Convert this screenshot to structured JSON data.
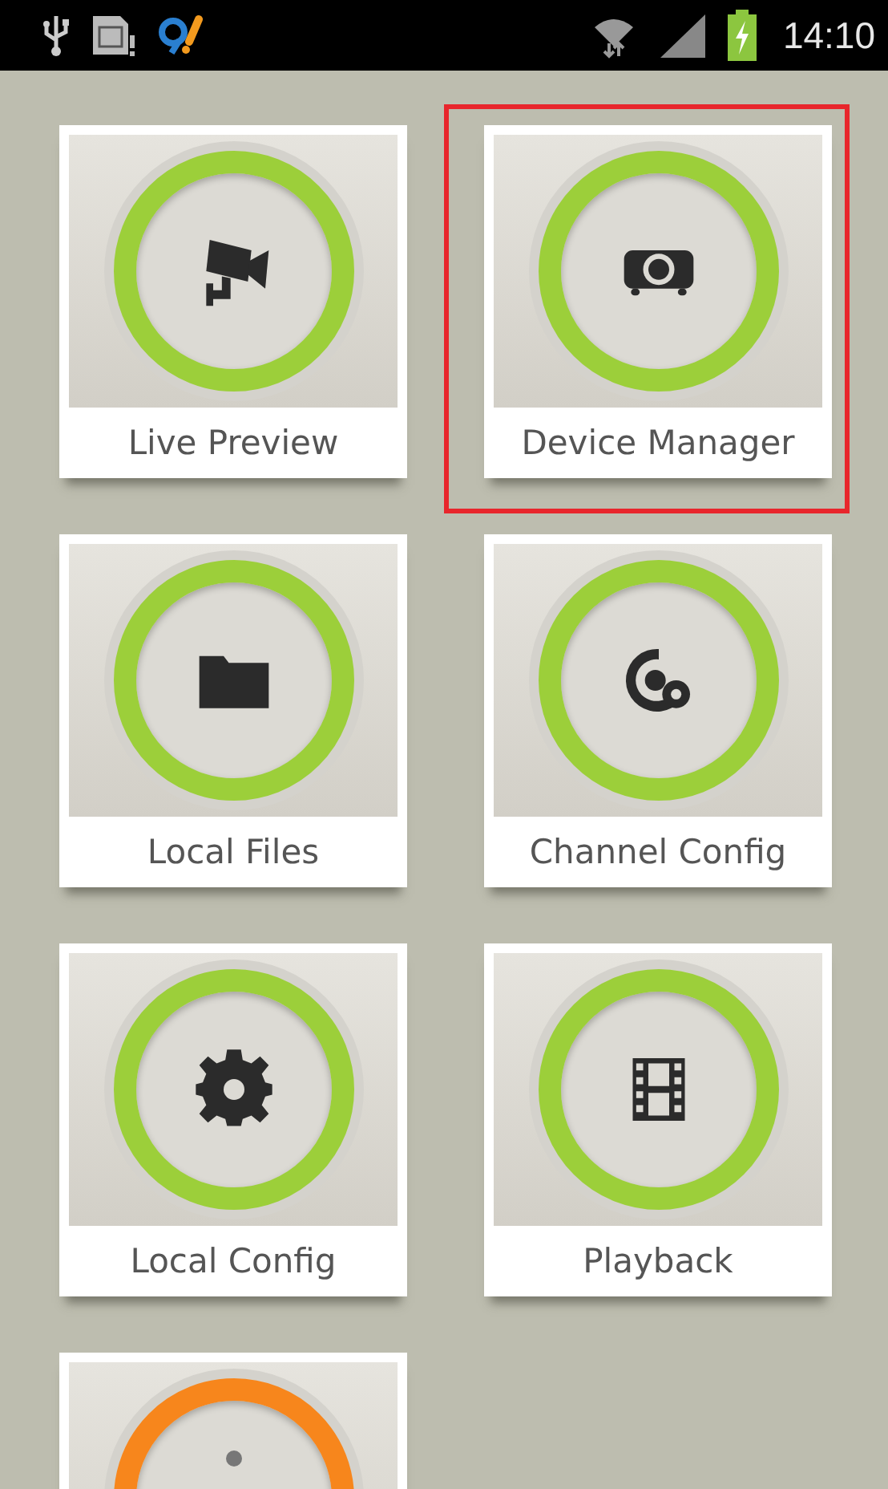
{
  "status_bar": {
    "time": "14:10"
  },
  "tiles": [
    {
      "label": "Live Preview",
      "kind": "camera",
      "color": "#9ccf3a",
      "selected": false
    },
    {
      "label": "Device Manager",
      "kind": "projector",
      "color": "#9ccf3a",
      "selected": true
    },
    {
      "label": "Local Files",
      "kind": "folder",
      "color": "#9ccf3a",
      "selected": false
    },
    {
      "label": "Channel Config",
      "kind": "cameragear",
      "color": "#9ccf3a",
      "selected": false
    },
    {
      "label": "Local Config",
      "kind": "gear",
      "color": "#9ccf3a",
      "selected": false
    },
    {
      "label": "Playback",
      "kind": "film",
      "color": "#9ccf3a",
      "selected": false
    },
    {
      "kind": "dot",
      "color": "#f7861c",
      "selected": false
    }
  ]
}
